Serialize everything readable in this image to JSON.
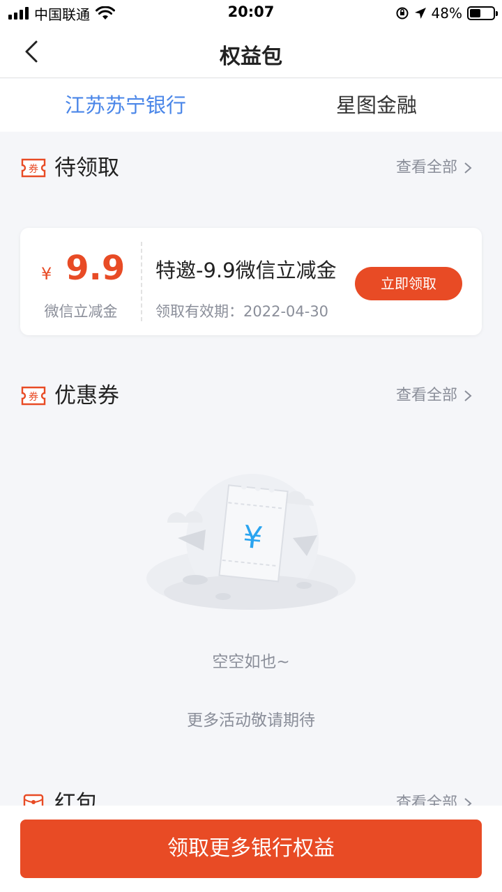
{
  "status_bar": {
    "carrier": "中国联通",
    "time": "20:07",
    "battery_percent": "48%",
    "battery_level": 0.48
  },
  "nav": {
    "title": "权益包",
    "back_icon": "chevron-left-icon"
  },
  "tabs": [
    {
      "label": "江苏苏宁银行",
      "active": true
    },
    {
      "label": "星图金融",
      "active": false
    }
  ],
  "sections": {
    "pending": {
      "title": "待领取",
      "view_all": "查看全部",
      "icon_text": "券",
      "card": {
        "currency": "¥",
        "amount": "9.9",
        "amount_label": "微信立减金",
        "title": "特邀-9.9微信立减金",
        "validity": "领取有效期：2022-04-30",
        "button": "立即领取"
      }
    },
    "coupons": {
      "title": "优惠券",
      "view_all": "查看全部",
      "icon_text": "券",
      "empty_title": "空空如也~",
      "empty_subtitle": "更多活动敬请期待"
    },
    "red_packets": {
      "title": "红包",
      "view_all": "查看全部"
    }
  },
  "bottom": {
    "cta": "领取更多银行权益"
  },
  "colors": {
    "accent": "#e84b25",
    "tab_active": "#4a86e8",
    "muted": "#8a8e99",
    "background": "#f5f6f9"
  }
}
